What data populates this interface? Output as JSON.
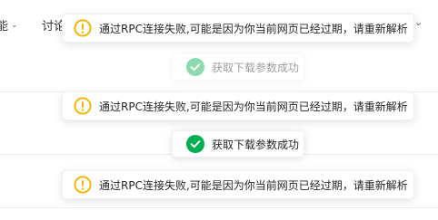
{
  "nav": {
    "item_1_label": "能",
    "item_2_label": "讨论"
  },
  "messages": [
    {
      "type": "warning",
      "text": "通过RPC连接失败,可能是因为你当前网页已经过期，请重新解析"
    },
    {
      "type": "success",
      "text": "获取下载参数成功",
      "fading": true
    },
    {
      "type": "warning",
      "text": "通过RPC连接失败,可能是因为你当前网页已经过期，请重新解析"
    },
    {
      "type": "success",
      "text": "获取下载参数成功"
    },
    {
      "type": "warning",
      "text": "通过RPC连接失败,可能是因为你当前网页已经过期，请重新解析"
    }
  ],
  "colors": {
    "warning": "#f7b500",
    "success": "#00b050"
  },
  "icons": {
    "warning": "warning-circle-icon",
    "success": "check-circle-icon",
    "nav_caret": "chevron-down-icon"
  }
}
